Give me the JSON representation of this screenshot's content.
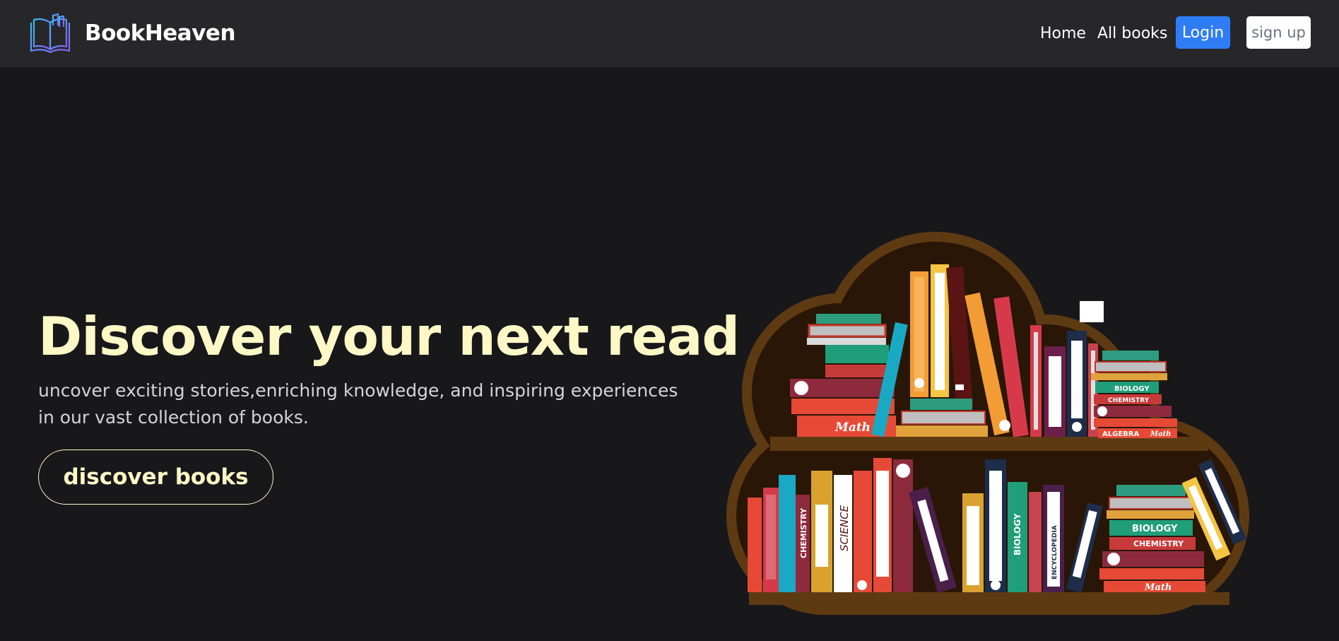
{
  "brand": {
    "name": "BookHeaven",
    "logo_icon": "open-book-icon"
  },
  "nav": {
    "home": "Home",
    "all_books": "All books",
    "login": "Login",
    "sign_up": "sign up"
  },
  "hero": {
    "title": "Discover your next read",
    "subtitle": "uncover exciting stories,enriching knowledge, and inspiring experiences in our vast collection of books.",
    "cta": "discover books"
  },
  "illustration": {
    "icon": "cloud-bookshelf-illustration",
    "spine_labels": {
      "top_math": "Math",
      "top_biology": "BIOLOGY",
      "top_chemistry": "CHEMISTRY",
      "top_algebra": "ALGEBRA",
      "top_math_small": "Math",
      "bottom_chemistry": "CHEMISTRY",
      "bottom_science": "SCIENCE",
      "bottom_biology": "BIOLOGY",
      "bottom_encyclopedia": "ENCYCLOPEDIA",
      "bottom_biology_stack": "BIOLOGY",
      "bottom_chemistry_stack": "CHEMISTRY",
      "bottom_math": "Math"
    }
  },
  "colors": {
    "background": "#18181b",
    "navbar": "#27272a",
    "accent_text": "#fdf8c6",
    "login_button": "#2f7df6",
    "shelf_frame": "#5e3a13",
    "shelf_inner": "#2a1606"
  }
}
